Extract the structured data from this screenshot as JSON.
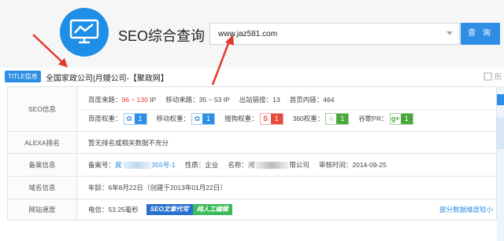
{
  "brand": {
    "title": "SEO综合查询"
  },
  "search": {
    "value": "www.jaz581.com",
    "button_label": "查 询"
  },
  "title_row": {
    "tag": "TITLE信息",
    "text": "全国家政公司|月嫂公司-【聚政网】",
    "history": "历"
  },
  "rows": {
    "seo": {
      "label": "SEO信息",
      "baidu_traffic_label": "百度来路：",
      "baidu_traffic_value": "96 ~ 130",
      "baidu_traffic_unit": "IP",
      "mobile_traffic_label": "移动来路：",
      "mobile_traffic_value": "35 ~ 53 IP",
      "outlinks_label": "出站链接：",
      "outlinks_value": "13",
      "home_links_label": "首页内链：",
      "home_links_value": "464",
      "baidu_weight_label": "百度权重：",
      "baidu_weight_value": "1",
      "mobile_weight_label": "移动权重：",
      "mobile_weight_value": "1",
      "sogou_weight_label": "搜狗权重：",
      "sogou_weight_value": "1",
      "so360_weight_label": "360权重：",
      "so360_weight_value": "1",
      "google_pr_label": "谷歌PR：",
      "google_pr_value": "1"
    },
    "alexa": {
      "label": "ALEXA排名",
      "text": "暂无排名或相关数据不充分"
    },
    "icp": {
      "label": "备案信息",
      "record_label": "备案号：",
      "record_prefix": "冀",
      "record_suffix": "355号-1",
      "nature_label": "性质：",
      "nature_value": "企业",
      "name_label": "名称：",
      "name_prefix": "河",
      "name_suffix": "限公司",
      "audit_label": "审核时间：",
      "audit_value": "2014-09-25"
    },
    "domain": {
      "label": "域名信息",
      "age_label": "年龄：",
      "age_value": "6年8月22日",
      "created": "（创建于2013年01月22日）"
    },
    "speed": {
      "label": "网站速度",
      "telecom": "电信：53.25毫秒",
      "banner_a": "SEO文章代写",
      "banner_b": "纯人工编辑",
      "more": "部分数据维度较小"
    }
  },
  "colors": {
    "accent": "#2e8ee6",
    "red": "#e84a3c",
    "green": "#4aa83a"
  },
  "icons": [
    "chart-monitor-icon",
    "paw-icon",
    "sogou-icon",
    "360-icon",
    "google-plus-icon",
    "red-arrow-icon"
  ]
}
